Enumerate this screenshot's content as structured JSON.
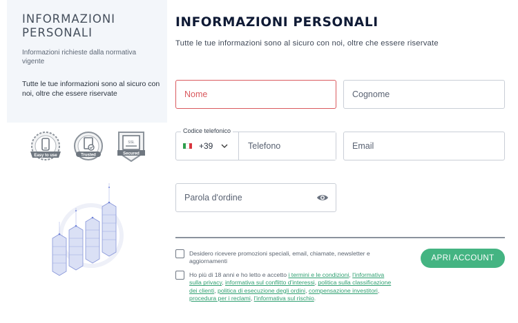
{
  "sidebar": {
    "title": "INFORMAZIONI PERSONALI",
    "subtitle": "Informazioni richieste dalla normativa vigente",
    "note": "Tutte le tue informazioni sono al sicuro con noi, oltre che essere riservate",
    "badges": [
      {
        "label": "Easy to use",
        "icon": "phone-icon"
      },
      {
        "label": "Trusted",
        "icon": "document-check-icon"
      },
      {
        "label": "Secured",
        "icon": "ssl-lock-icon"
      }
    ]
  },
  "form": {
    "title": "INFORMAZIONI PERSONALI",
    "subtitle": "Tutte le tue informazioni sono al sicuro con noi, oltre che essere riservate",
    "first_name_placeholder": "Nome",
    "last_name_placeholder": "Cognome",
    "phone_legend": "Codice telefonico",
    "country_code": "+39",
    "country_flag": "italy-flag-icon",
    "phone_placeholder": "Telefono",
    "email_placeholder": "Email",
    "password_placeholder": "Parola d'ordine",
    "consents": {
      "marketing": "Desidero ricevere promozioni speciali, email, chiamate, newsletter e aggiornamenti",
      "legal_prefix": "Ho più di 18 anni e ho letto e accetto ",
      "links": [
        "i termini e le condizioni",
        "l'informativa sulla privacy",
        "informativa sul conflitto d'interessi",
        "politica sulla classificazione dei clienti",
        "politica di esecuzione degli ordini",
        "compensazione investitori",
        "procedura per i reclami",
        "l'informativa sul rischio"
      ],
      "separator": ", ",
      "suffix": "."
    },
    "submit_label": "APRI ACCOUNT"
  },
  "colors": {
    "accent_green": "#44b482",
    "error_red": "#d9585d",
    "title_navy": "#0f1a35"
  }
}
